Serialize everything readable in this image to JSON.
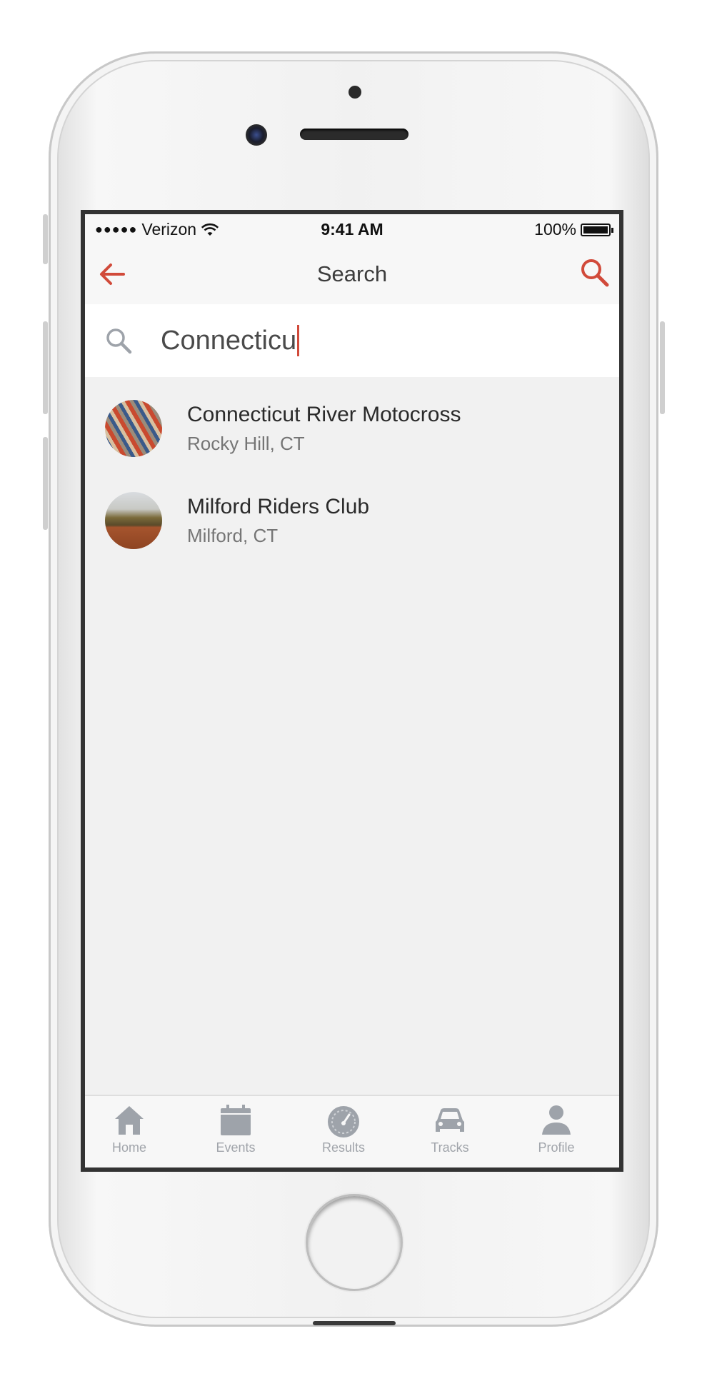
{
  "status_bar": {
    "signal": "●●●●●",
    "carrier": "Verizon",
    "time": "9:41 AM",
    "battery": "100%"
  },
  "nav": {
    "title": "Search"
  },
  "search": {
    "value": "Connecticu"
  },
  "results": [
    {
      "title": "Connecticut River Motocross",
      "subtitle": "Rocky Hill, CT"
    },
    {
      "title": "Milford Riders Club",
      "subtitle": "Milford, CT"
    }
  ],
  "tabs": [
    {
      "label": "Home",
      "icon": "home-icon"
    },
    {
      "label": "Events",
      "icon": "calendar-icon"
    },
    {
      "label": "Results",
      "icon": "speedometer-icon"
    },
    {
      "label": "Tracks",
      "icon": "car-icon"
    },
    {
      "label": "Profile",
      "icon": "person-icon"
    }
  ],
  "colors": {
    "accent": "#d14a3a",
    "tab_icon": "#9ea3aa",
    "background": "#f1f1f1"
  }
}
